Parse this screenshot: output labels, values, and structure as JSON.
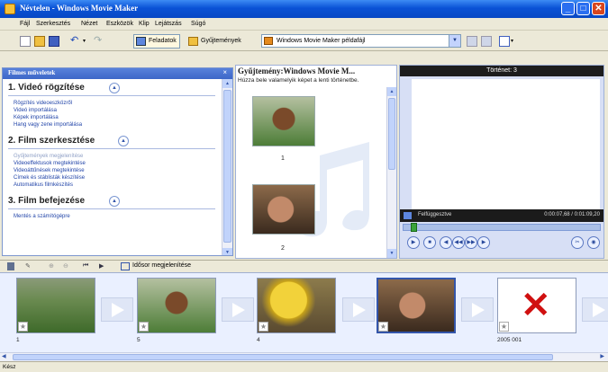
{
  "window": {
    "title": "Névtelen - Windows Movie Maker"
  },
  "menu": [
    "Fájl",
    "Szerkesztés",
    "Nézet",
    "Eszközök",
    "Klip",
    "Lejátszás",
    "Súgó"
  ],
  "toolbar": {
    "tasks_label": "Feladatok",
    "collections_label": "Gyűjtemények",
    "collection_combo": "Windows Movie Maker példafájl"
  },
  "taskpane": {
    "header": "Filmes műveletek",
    "close": "×",
    "sections": [
      {
        "title": "1. Videó rögzítése",
        "tasks": [
          "Rögzítés videoeszközről",
          "Videó importálása",
          "Képek importálása",
          "Hang vagy zene importálása"
        ]
      },
      {
        "title": "2. Film szerkesztése",
        "tasks": [
          "Gyűjtemények megjelenítése",
          "Videoeffektusok megtekintése",
          "Videoáttűnések megtekintése",
          "Címek és stáblisták készítése",
          "Automatikus filmkészítés"
        ]
      },
      {
        "title": "3. Film befejezése",
        "tasks": [
          "Mentés a számítógépre"
        ]
      }
    ]
  },
  "collection": {
    "heading": "Gyűjtemény:Windows Movie M...",
    "subheading": "Húzza bele valamelyik képet a lenti történetbe.",
    "clips": [
      "1",
      "2"
    ]
  },
  "preview": {
    "title": "Történet: 3",
    "status": "Felfüggesztve",
    "time": "0:00:07,68 / 0:01:09,20",
    "seek_fraction": 0.04
  },
  "storyboard": {
    "toggle_label": "Idősor megjelenítése",
    "items": [
      {
        "label": "1",
        "kind": "grass"
      },
      {
        "label": "5",
        "kind": "kid"
      },
      {
        "label": "4",
        "kind": "yellow"
      },
      {
        "label": "",
        "kind": "indoor"
      },
      {
        "label": "2005 001",
        "kind": "redx"
      }
    ]
  },
  "statusbar": {
    "text": "Kész"
  },
  "colors": {
    "titlebar": "#0a52d6",
    "taskpane": "#d6dff7",
    "storyboard": "#eaf0ff",
    "error_x": "#d01010"
  }
}
